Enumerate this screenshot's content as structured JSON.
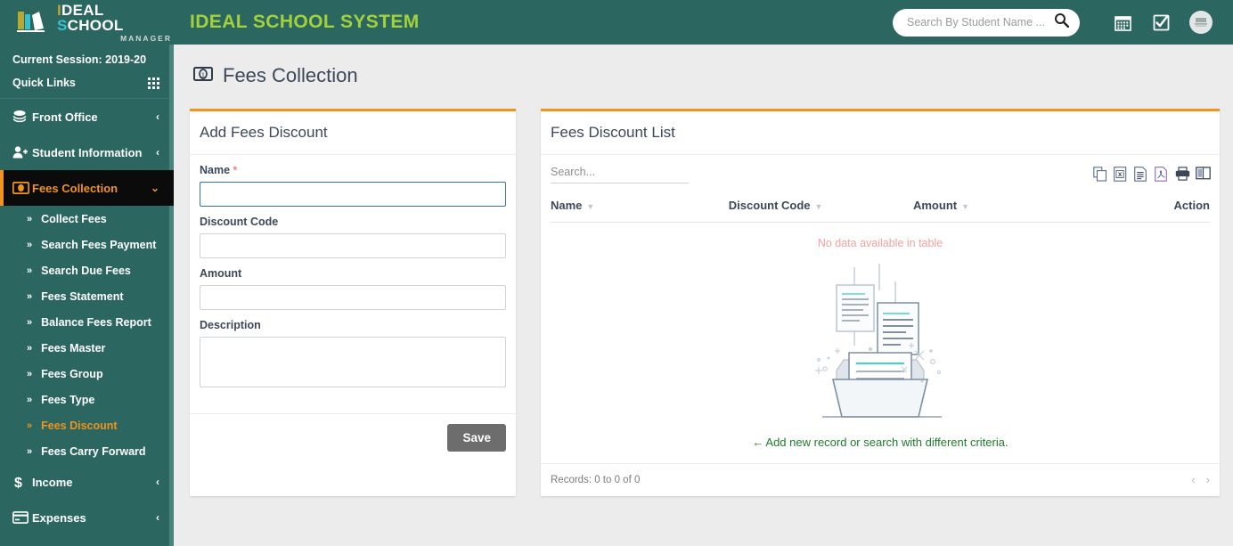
{
  "header": {
    "logo": {
      "part1": "I",
      "part2": "DEAL",
      "part3": " S",
      "part4": "CHOOL",
      "subtitle": "MANAGER",
      "icon": "books-logo-icon"
    },
    "app_title": "IDEAL SCHOOL SYSTEM",
    "search": {
      "placeholder": "Search By Student Name ...",
      "value": "",
      "icon": "search-icon"
    },
    "icons": {
      "calendar": "calendar-icon",
      "tasks": "checkbox-check-icon",
      "avatar": "user-avatar"
    }
  },
  "sidebar": {
    "session_label": "Current Session: 2019-20",
    "quick_links_label": "Quick Links",
    "quick_links_icon": "grid-apps-icon",
    "items": [
      {
        "label": "Front Office",
        "icon": "layers-icon",
        "caret": "‹",
        "active": false
      },
      {
        "label": "Student Information",
        "icon": "user-plus-icon",
        "caret": "‹",
        "active": false
      },
      {
        "label": "Fees Collection",
        "icon": "money-icon",
        "caret": "⌄",
        "active": true
      },
      {
        "label": "Income",
        "icon": "dollar-icon",
        "caret": "‹",
        "active": false
      },
      {
        "label": "Expenses",
        "icon": "credit-card-icon",
        "caret": "‹",
        "active": false
      }
    ],
    "sub_items": [
      {
        "label": "Collect Fees",
        "active": false
      },
      {
        "label": "Search Fees Payment",
        "active": false
      },
      {
        "label": "Search Due Fees",
        "active": false
      },
      {
        "label": "Fees Statement",
        "active": false
      },
      {
        "label": "Balance Fees Report",
        "active": false
      },
      {
        "label": "Fees Master",
        "active": false
      },
      {
        "label": "Fees Group",
        "active": false
      },
      {
        "label": "Fees Type",
        "active": false
      },
      {
        "label": "Fees Discount",
        "active": true
      },
      {
        "label": "Fees Carry Forward",
        "active": false
      }
    ]
  },
  "page": {
    "title": "Fees Collection",
    "title_icon": "money-note-icon"
  },
  "form_card": {
    "title": "Add Fees Discount",
    "fields": [
      {
        "label": "Name",
        "required": true,
        "value": "",
        "placeholder": "",
        "type": "text",
        "focused": true,
        "name": "name-field"
      },
      {
        "label": "Discount Code",
        "required": false,
        "value": "",
        "placeholder": "",
        "type": "text",
        "focused": false,
        "name": "discount-code-field"
      },
      {
        "label": "Amount",
        "required": false,
        "value": "",
        "placeholder": "",
        "type": "text",
        "focused": false,
        "name": "amount-field"
      },
      {
        "label": "Description",
        "required": false,
        "value": "",
        "placeholder": "",
        "type": "textarea",
        "focused": false,
        "name": "description-field"
      }
    ],
    "required_marker": "*",
    "save_label": "Save"
  },
  "list_card": {
    "title": "Fees Discount List",
    "search_placeholder": "Search...",
    "search_value": "",
    "export_icons": [
      {
        "name": "copy-icon",
        "title": "Copy"
      },
      {
        "name": "excel-icon",
        "title": "Excel"
      },
      {
        "name": "csv-icon",
        "title": "CSV"
      },
      {
        "name": "pdf-icon",
        "title": "PDF"
      },
      {
        "name": "print-icon",
        "title": "Print"
      },
      {
        "name": "column-visibility-icon",
        "title": "Column visibility"
      }
    ],
    "columns": [
      {
        "label": "Name",
        "sortable": true
      },
      {
        "label": "Discount Code",
        "sortable": true
      },
      {
        "label": "Amount",
        "sortable": true
      },
      {
        "label": "Action",
        "sortable": false
      }
    ],
    "rows": [],
    "empty_message": "No data available in table",
    "empty_illustration": "empty-box-documents-illustration",
    "empty_hint_arrow": "←",
    "empty_hint": "Add new record or search with different criteria.",
    "records_info": "Records: 0 to 0 of 0",
    "pager": {
      "prev": "‹",
      "next": "›"
    }
  },
  "colors": {
    "brand_teal": "#2b6660",
    "accent_orange": "#f0941e",
    "title_green": "#a3d13a",
    "active_nav_bg": "#0b0b0b",
    "empty_text": "#f3a1a1",
    "hint_green": "#1f7a2e",
    "save_gray": "#6d6d6d",
    "page_bg": "#ececed"
  }
}
